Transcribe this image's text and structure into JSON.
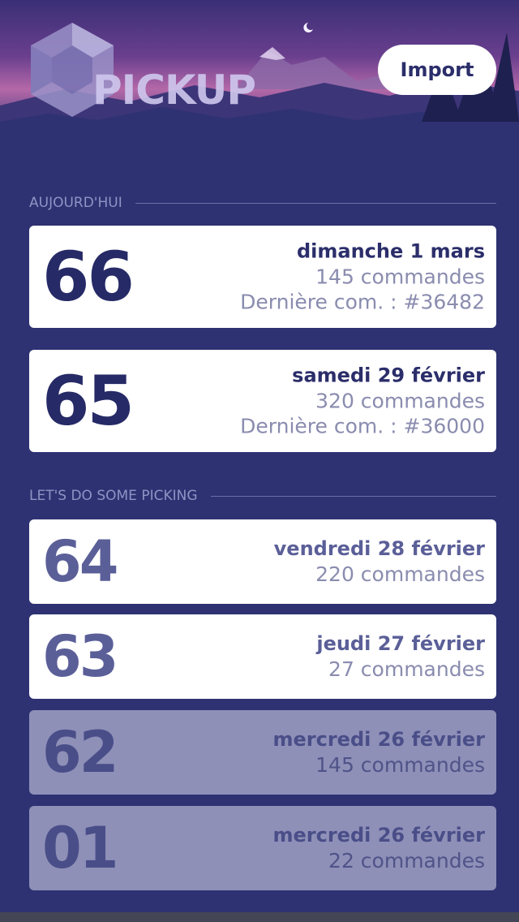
{
  "app": {
    "logo_text": "PICKUP"
  },
  "header": {
    "import_label": "Import"
  },
  "sections": {
    "today": "AUJOURD'HUI",
    "picking": "LET'S DO SOME PICKING"
  },
  "today_cards": [
    {
      "number": "66",
      "date": "dimanche 1 mars",
      "count": "145 commandes",
      "last": "Dernière com. : #36482"
    },
    {
      "number": "65",
      "date": "samedi 29 février",
      "count": "320 commandes",
      "last": "Dernière com. : #36000"
    }
  ],
  "picking_cards": [
    {
      "number": "64",
      "date": "vendredi 28 février",
      "count": "220 commandes"
    },
    {
      "number": "63",
      "date": "jeudi 27 février",
      "count": "27 commandes"
    },
    {
      "number": "62",
      "date": "mercredi 26 février",
      "count": "145 commandes"
    },
    {
      "number": "01",
      "date": "mercredi 26 février",
      "count": "22 commandes"
    }
  ],
  "colors": {
    "background": "#2e3272",
    "card": "#ffffff",
    "card_dim": "#8e90b8",
    "accent": "#262a66"
  }
}
